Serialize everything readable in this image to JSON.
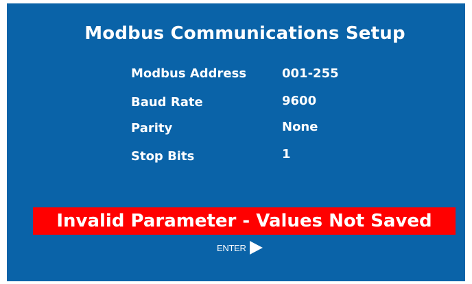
{
  "screen": {
    "title": "Modbus Communications Setup",
    "background_color": "#0a63a8"
  },
  "parameters": [
    {
      "label": "Modbus Address",
      "value": "001-255"
    },
    {
      "label": "Baud Rate",
      "value": "9600"
    },
    {
      "label": "Parity",
      "value": "None"
    },
    {
      "label": "Stop Bits",
      "value": "1"
    }
  ],
  "error": {
    "message": "Invalid Parameter - Values Not Saved",
    "color": "#ff0000"
  },
  "enter": {
    "label": "ENTER",
    "icon": "play-arrow-icon"
  }
}
